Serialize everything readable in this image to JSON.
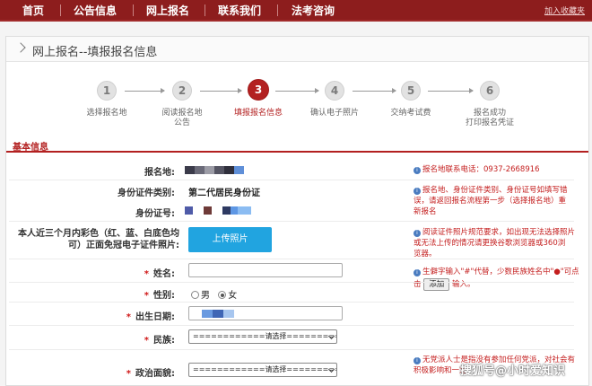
{
  "nav": {
    "items": [
      "首页",
      "公告信息",
      "网上报名",
      "联系我们",
      "法考咨询"
    ],
    "favorite": "加入收藏夹"
  },
  "panel": {
    "title": "网上报名--填报报名信息"
  },
  "steps": [
    {
      "num": "1",
      "label": "选择报名地"
    },
    {
      "num": "2",
      "label": "阅读报名地\n公告"
    },
    {
      "num": "3",
      "label": "填报报名信息"
    },
    {
      "num": "4",
      "label": "确认电子照片"
    },
    {
      "num": "5",
      "label": "交纳考试费"
    },
    {
      "num": "6",
      "label": "报名成功\n打印报名凭证"
    }
  ],
  "active_step": 3,
  "section": {
    "title": "基本信息"
  },
  "form": {
    "site_label": "报名地:",
    "idtype_label": "身份证件类别:",
    "idtype_value": "第二代居民身份证",
    "idno_label": "身份证号:",
    "photo_label_1": "本人近三个月内彩色（红、蓝、白底色均",
    "photo_label_2": "可）正面免冠电子证件照片:",
    "upload_label": "上传照片",
    "name_label": "姓名:",
    "gender_label": "性别:",
    "gender_male": "男",
    "gender_female": "女",
    "gender_selected": "女",
    "birth_label": "出生日期:",
    "ethnicity_label": "民族:",
    "ethnicity_value": "============请选择============",
    "politics_label": "政治面貌:",
    "politics_value": "============请选择============"
  },
  "tips": {
    "site": "报名地联系电话：0937-2668916",
    "id_1": "报名地、身份证件类别、身份证号如填写错",
    "id_2": "误，请返回报名流程第一步",
    "id_link": "（选择报名地）",
    "id_3": "重",
    "id_4": "新报名",
    "photo_1": "阅读证件照片规范要求，如出现无法选择照片",
    "photo_2": "或无法上传的情况请更换谷歌浏览器或360浏",
    "photo_3": "览器。",
    "name_1": "生僻字输入\"#\"代替，少数民族姓名中\"●\"可点",
    "name_2": "击",
    "name_add": "添加",
    "name_3": "输入。",
    "politics_1": "无党派人士是指没有参加任何党派，对社会有",
    "politics_2": "积极影响和一定"
  },
  "watermark": "搜狐号@小时爱知识",
  "colors": {
    "nav_bg": "#8d1d1d",
    "accent": "#b32020",
    "upload": "#21a4e0"
  }
}
